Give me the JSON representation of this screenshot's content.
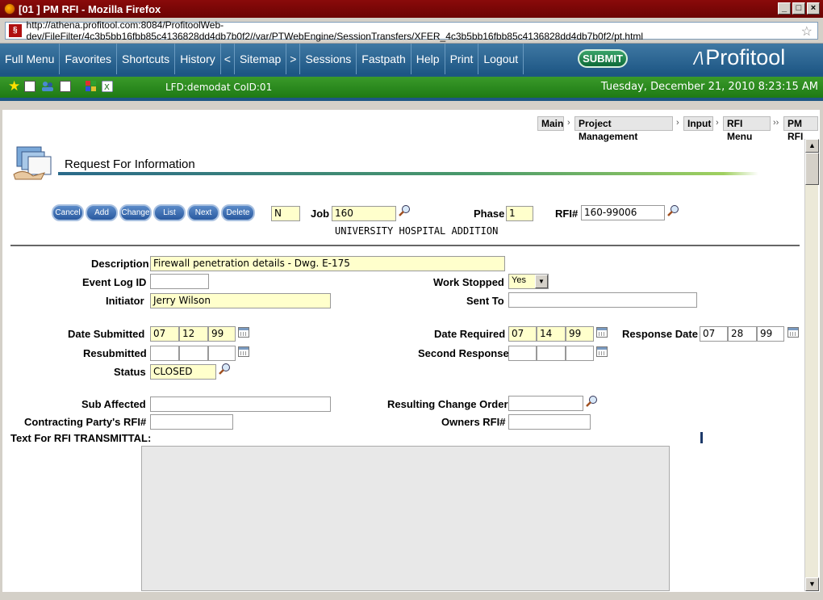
{
  "window": {
    "title": "[01 ] PM RFI - Mozilla Firefox"
  },
  "address": {
    "url": "http://athena.profitool.com:8084/ProfitoolWeb-dev/FileFilter/4c3b5bb16fbb85c4136828dd4db7b0f2//var/PTWebEngine/SessionTransfers/XFER_4c3b5bb16fbb85c4136828dd4db7b0f2/pt.html"
  },
  "nav": {
    "items": [
      "Full Menu",
      "Favorites",
      "Shortcuts",
      "History",
      "<",
      "Sitemap",
      ">",
      "Sessions",
      "Fastpath",
      "Help",
      "Print",
      "Logout"
    ],
    "submit": "SUBMIT",
    "logo": "Profitool"
  },
  "status": {
    "lfd": "LFD:demodat CoID:01",
    "datetime": "Tuesday, December 21, 2010 8:23:15 AM"
  },
  "breadcrumb": [
    "Main",
    "Project Management",
    "Input",
    "RFI Menu",
    "PM RFI"
  ],
  "page": {
    "title": "Request For Information"
  },
  "actions": [
    "Cancel",
    "Add",
    "Change",
    "List",
    "Next",
    "Delete"
  ],
  "header": {
    "mode": "N",
    "job_label": "Job",
    "job": "160",
    "phase_label": "Phase",
    "phase": "1",
    "rfi_label": "RFI#",
    "rfi": "160-99006",
    "job_name": "UNIVERSITY HOSPITAL ADDITION"
  },
  "form": {
    "description_label": "Description",
    "description": "Firewall penetration details - Dwg. E-175",
    "event_log_label": "Event Log ID",
    "event_log": "",
    "work_stopped_label": "Work Stopped",
    "work_stopped": "Yes",
    "initiator_label": "Initiator",
    "initiator": "Jerry Wilson",
    "sent_to_label": "Sent To",
    "sent_to": "",
    "date_submitted_label": "Date Submitted",
    "date_submitted": [
      "07",
      "12",
      "99"
    ],
    "date_required_label": "Date Required",
    "date_required": [
      "07",
      "14",
      "99"
    ],
    "response_date_label": "Response Date",
    "response_date": [
      "07",
      "28",
      "99"
    ],
    "resubmitted_label": "Resubmitted",
    "second_response_label": "Second Response",
    "status_label": "Status",
    "status": "CLOSED",
    "sub_affected_label": "Sub Affected",
    "resulting_co_label": "Resulting Change Order",
    "contracting_rfi_label": "Contracting Party's RFI#",
    "owners_rfi_label": "Owners RFI#",
    "text_label": "Text For RFI TRANSMITTAL:"
  }
}
